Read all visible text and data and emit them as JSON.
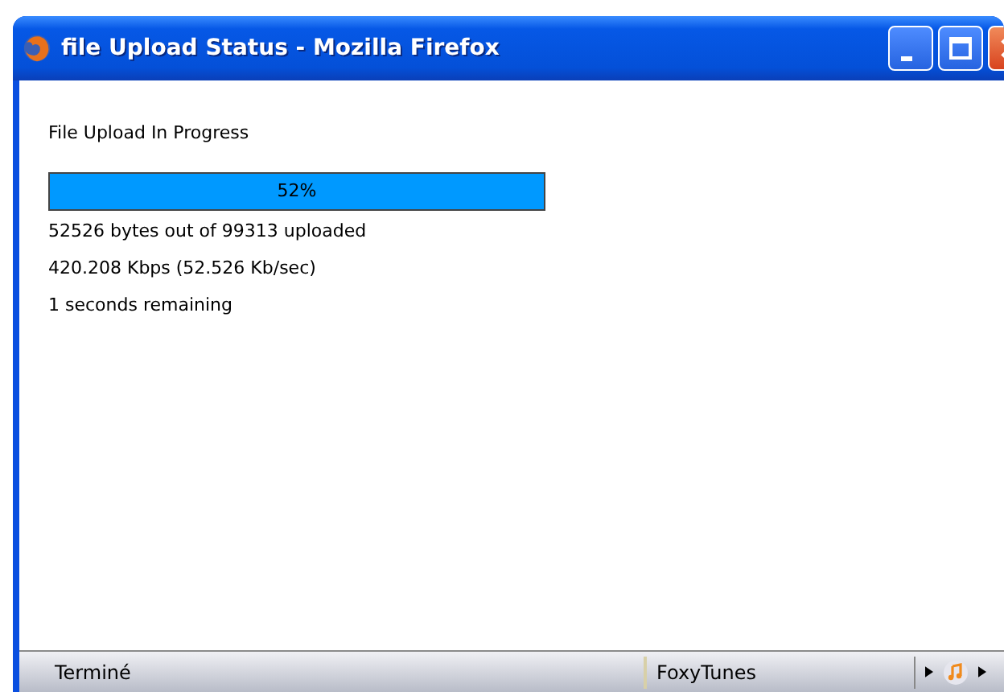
{
  "window": {
    "title": "file Upload Status - Mozilla Firefox"
  },
  "heading": "File Upload In Progress",
  "progress": {
    "level": 1,
    "label": "52%"
  },
  "details": [
    "52526 bytes out of 99313 uploaded",
    "420.208 Kbps (52.526 Kb/sec)",
    "1 seconds remaining"
  ],
  "status_bar": {
    "status": "Terminé",
    "addon": "FoxyTunes"
  }
}
